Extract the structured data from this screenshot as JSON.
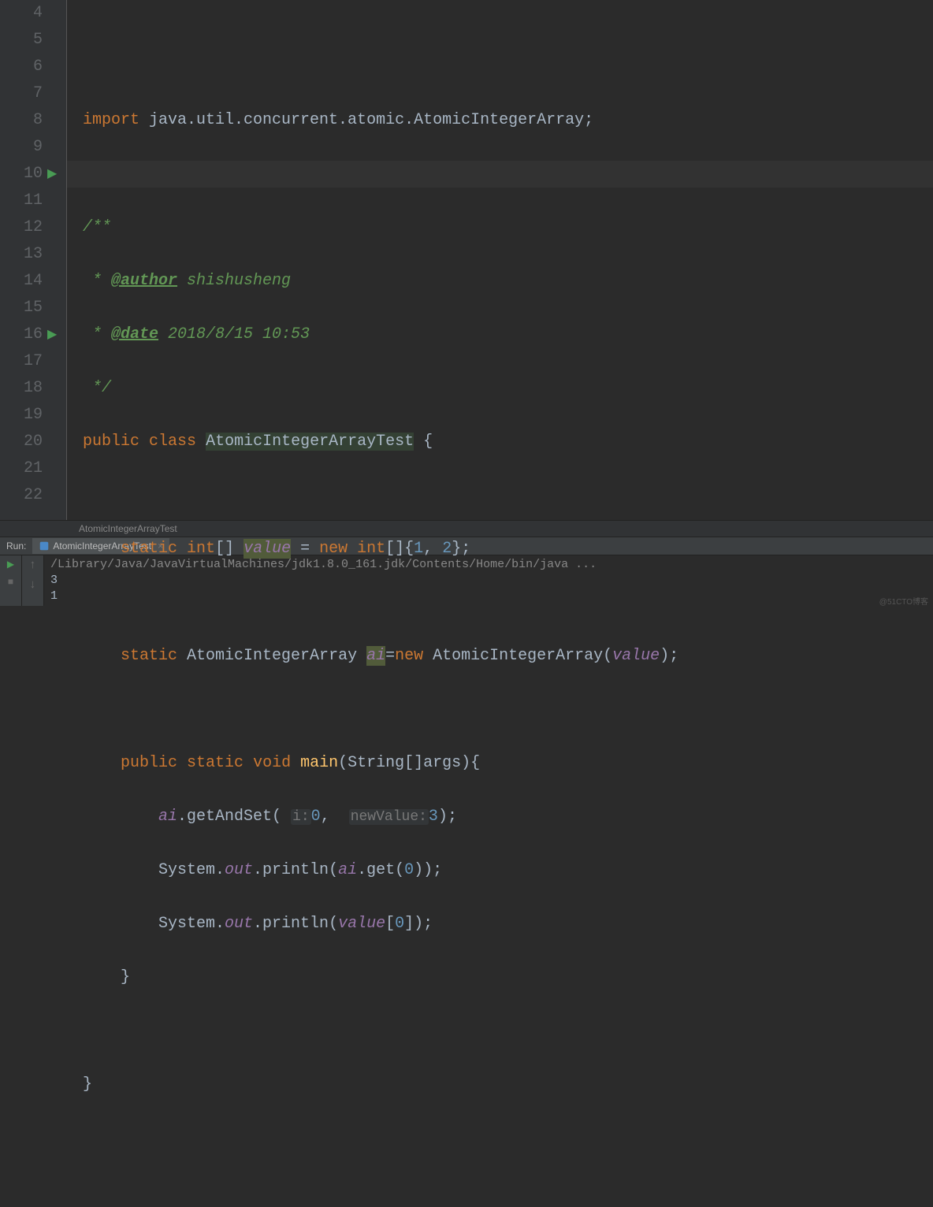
{
  "gutter": {
    "lines": [
      "4",
      "5",
      "6",
      "7",
      "8",
      "9",
      "10",
      "11",
      "12",
      "13",
      "14",
      "15",
      "16",
      "17",
      "18",
      "19",
      "20",
      "21",
      "22"
    ]
  },
  "code": {
    "l4": {
      "import": "import",
      "pkg": " java.util.concurrent.atomic.AtomicIntegerArray;"
    },
    "l6": "/**",
    "l7": {
      "star": " * ",
      "tag": "@author",
      "val": " shishusheng"
    },
    "l8": {
      "star": " * ",
      "tag": "@date",
      "val": " 2018/8/15 10:53"
    },
    "l9": " */",
    "l10": {
      "pub": "public",
      "cls": "class",
      "name": "AtomicIntegerArrayTest",
      "brace": " {"
    },
    "l12": {
      "static": "static",
      "int": "int",
      "brack": "[] ",
      "var": "value",
      "eq": " = ",
      "new": "new",
      "int2": "int",
      "arr": "[]{",
      "n1": "1",
      "c": ", ",
      "n2": "2",
      "end": "};"
    },
    "l14": {
      "static": "static",
      "type": " AtomicIntegerArray ",
      "var": "ai",
      "eq": "=",
      "new": "new",
      "ctor": " AtomicIntegerArray(",
      "arg": "value",
      "end": ");"
    },
    "l16": {
      "pub": "public",
      "static": "static",
      "void": "void",
      "main": "main",
      "args": "(String[]args){"
    },
    "l17": {
      "indent": "        ",
      "ai": "ai",
      "dot": ".getAndSet( ",
      "h1": "i:",
      "n0": "0",
      "c": ",  ",
      "h2": "newValue:",
      "n3": "3",
      "end": ");"
    },
    "l18": {
      "indent": "        System.",
      "out": "out",
      "call": ".println(",
      "ai": "ai",
      "get": ".get(",
      "z": "0",
      "end": "));"
    },
    "l19": {
      "indent": "        System.",
      "out": "out",
      "call": ".println(",
      "v": "value",
      "br": "[",
      "z": "0",
      "end": "]);"
    },
    "l20": "    }",
    "l22": "}"
  },
  "breadcrumb": "AtomicIntegerArrayTest",
  "run": {
    "label": "Run:",
    "tab": "AtomicIntegerArrayTest"
  },
  "console": {
    "cmd": "/Library/Java/JavaVirtualMachines/jdk1.8.0_161.jdk/Contents/Home/bin/java ...",
    "out1": "3",
    "out2": "1"
  },
  "watermark": "@51CTO博客"
}
